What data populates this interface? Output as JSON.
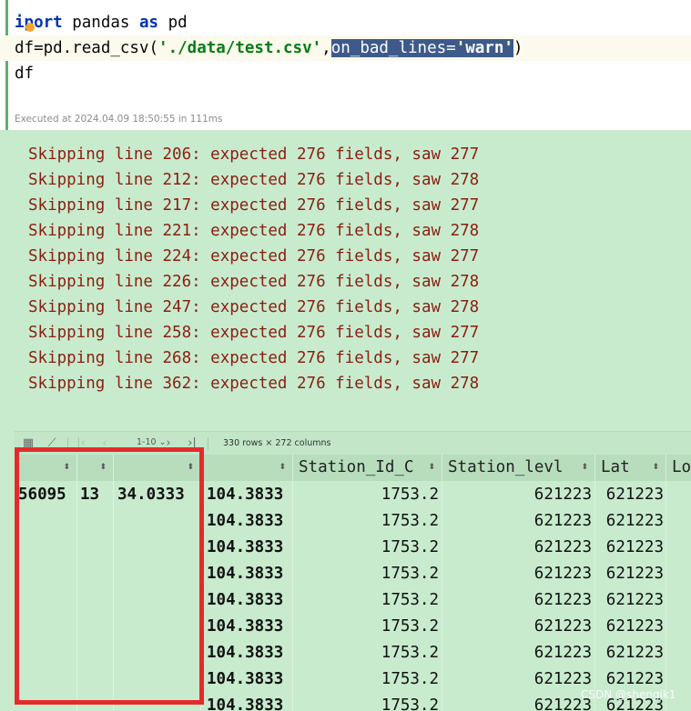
{
  "code": {
    "line1": {
      "kw_part1": "i",
      "kw_part2": "port",
      "plain1": " pandas ",
      "kw_as": "as",
      "plain2": " pd"
    },
    "line2": {
      "prefix": "df=pd.read_csv(",
      "path": "'./data/test.csv'",
      "comma": ",",
      "sel_arg": "on_bad_lines=",
      "sel_str": "'warn'",
      "suffix": ")"
    },
    "line3": "df",
    "exec_status": "Executed at 2024.04.09 18:50:55 in 111ms"
  },
  "warnings": [
    "Skipping line 206: expected 276 fields, saw 277",
    "Skipping line 212: expected 276 fields, saw 278",
    "Skipping line 217: expected 276 fields, saw 277",
    "Skipping line 221: expected 276 fields, saw 278",
    "Skipping line 224: expected 276 fields, saw 277",
    "Skipping line 226: expected 276 fields, saw 278",
    "Skipping line 247: expected 276 fields, saw 278",
    "Skipping line 258: expected 276 fields, saw 277",
    "Skipping line 268: expected 276 fields, saw 277",
    "Skipping line 362: expected 276 fields, saw 278"
  ],
  "toolbar": {
    "table_view_icon": "grid-icon",
    "chart_view_icon": "line-chart-icon",
    "range": "1-10",
    "range_chevron": "⌄",
    "info": "330 rows × 272 columns"
  },
  "table": {
    "sort_glyph": "⬍",
    "headers": [
      "",
      "",
      "",
      "",
      "Station_Id_C",
      "Station_levl",
      "Lat",
      "Lo"
    ],
    "first_row_cells": [
      "56095",
      "13",
      "34.0333"
    ],
    "index_values": [
      "104.3833",
      "104.3833",
      "104.3833",
      "104.3833",
      "104.3833",
      "104.3833",
      "104.3833",
      "104.3833",
      "104.3833"
    ],
    "station_id_values": [
      "1753.2",
      "1753.2",
      "1753.2",
      "1753.2",
      "1753.2",
      "1753.2",
      "1753.2",
      "1753.2",
      "1753.2"
    ],
    "station_levl_values": [
      "621223",
      "621223",
      "621223",
      "621223",
      "621223",
      "621223",
      "621223",
      "621223",
      "621223"
    ],
    "lat_values": [
      "621223",
      "621223",
      "621223",
      "621223",
      "621223",
      "621223",
      "621223",
      "621223",
      "621223"
    ]
  },
  "watermark": "CSDN @shengjk1",
  "colors": {
    "output_background": "#c8ebce",
    "warning_text": "#8a1f11",
    "keyword": "#0033b3",
    "string": "#067d17",
    "selection": "#3d5a8a",
    "annotation_red": "#e32b2b"
  }
}
